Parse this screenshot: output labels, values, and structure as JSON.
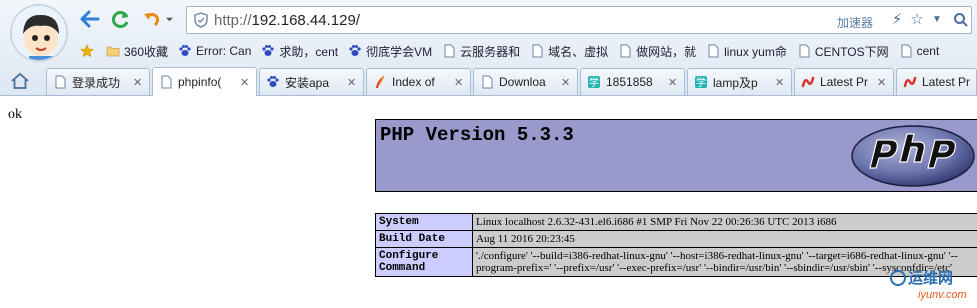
{
  "browser": {
    "url_protocol": "http://",
    "url_host": "192.168.44.129/",
    "accelerator_label": "加速器",
    "bookmarks": [
      {
        "label": "360收藏",
        "icon": "folder-icon"
      },
      {
        "label": "Error: Can",
        "icon": "baidu-paw-icon"
      },
      {
        "label": "求助，cent",
        "icon": "baidu-paw-icon"
      },
      {
        "label": "彻底学会VM",
        "icon": "baidu-paw-icon"
      },
      {
        "label": "云服务器和",
        "icon": "page-icon"
      },
      {
        "label": "域名、虚拟",
        "icon": "page-icon"
      },
      {
        "label": "做网站，就",
        "icon": "page-icon"
      },
      {
        "label": "linux yum命",
        "icon": "page-icon"
      },
      {
        "label": "CENTOS下网",
        "icon": "page-icon"
      },
      {
        "label": "cent",
        "icon": "page-icon"
      }
    ],
    "tabs": [
      {
        "label": "登录成功",
        "icon": "page-icon",
        "active": false
      },
      {
        "label": "phpinfo(",
        "icon": "page-icon",
        "active": true
      },
      {
        "label": "安装apa",
        "icon": "baidu-paw-icon",
        "active": false
      },
      {
        "label": "Index of",
        "icon": "feather-icon",
        "active": false
      },
      {
        "label": "Downloa",
        "icon": "page-icon",
        "active": false
      },
      {
        "label": "1851858",
        "icon": "study-icon",
        "active": false
      },
      {
        "label": "lamp及p",
        "icon": "study-icon",
        "active": false
      },
      {
        "label": "Latest Pr",
        "icon": "red-swirl-icon",
        "active": false
      },
      {
        "label": "Latest Pr",
        "icon": "red-swirl-icon",
        "active": false
      }
    ]
  },
  "page": {
    "ok_text": "ok",
    "php_version_title": "PHP Version 5.3.3",
    "info_rows": [
      {
        "key": "System",
        "value": "Linux localhost 2.6.32-431.el6.i686 #1 SMP Fri Nov 22 00:26:36 UTC 2013 i686"
      },
      {
        "key": "Build Date",
        "value": "Aug 11 2016 20:23:45"
      },
      {
        "key": "Configure Command",
        "value": "'./configure' '--build=i386-redhat-linux-gnu' '--host=i386-redhat-linux-gnu' '--target=i686-redhat-linux-gnu' '--program-prefix=' '--prefix=/usr' '--exec-prefix=/usr' '--bindir=/usr/bin' '--sbindir=/usr/sbin' '--sysconfdir=/etc'"
      }
    ]
  },
  "watermark": {
    "text1": "运维网",
    "text2": "iyunv.com"
  },
  "colors": {
    "php_header_bg": "#9999cc",
    "php_key_bg": "#ccccff",
    "php_value_bg": "#cccccc",
    "chrome_bg": "#dde7f2",
    "nav_blue": "#2f7ed8",
    "refresh_green": "#2aa84a",
    "undo_orange": "#e88a1a"
  }
}
